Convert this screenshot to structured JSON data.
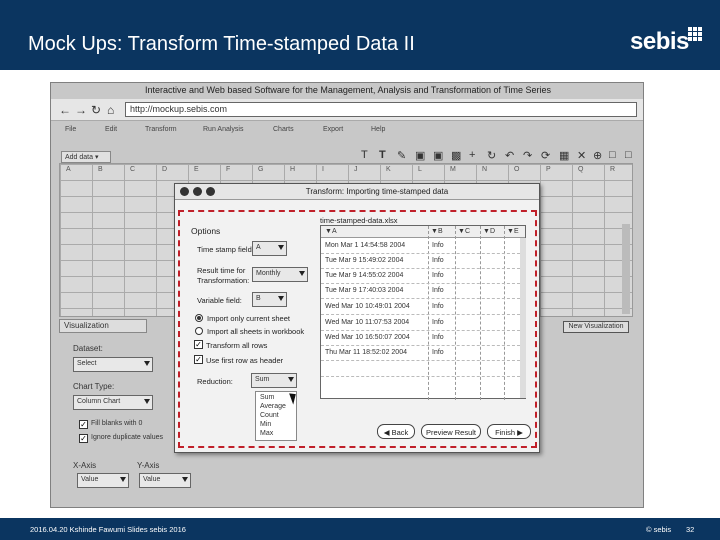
{
  "slide": {
    "title": "Mock Ups: Transform Time-stamped Data II",
    "logo": "sebis",
    "footer_left": "2016.04.20 Kshinde Fawumi Slides sebis 2016",
    "footer_copyright": "© sebis",
    "page_number": "32"
  },
  "app": {
    "title": "Interactive and Web based Software for the Management, Analysis and Transformation of Time Series",
    "url": "http://mockup.sebis.com",
    "menu": [
      "File",
      "Edit",
      "Transform",
      "Run Analysis",
      "Charts",
      "Export",
      "Help"
    ],
    "sheet_tab": "Add data",
    "grid_cols": [
      "A",
      "B",
      "C",
      "D",
      "E",
      "F",
      "G",
      "H",
      "I",
      "J",
      "K",
      "L",
      "M",
      "N",
      "O",
      "P",
      "Q",
      "R"
    ],
    "toolbar_icons": [
      "text-icon",
      "bold-icon",
      "edit-icon",
      "image-icon",
      "image2-icon",
      "save-icon",
      "add-icon",
      "refresh-icon",
      "undo-icon",
      "redo-icon",
      "rotate-icon",
      "trash-icon",
      "close-icon",
      "zoom-in-icon",
      "lock-icon",
      "unlock-icon"
    ]
  },
  "viz": {
    "header": "Visualization",
    "new_button": "New Visualization",
    "dataset_label": "Dataset:",
    "dataset_value": "Select",
    "chart_type_label": "Chart Type:",
    "chart_type_value": "Column Chart",
    "fill_blanks": "Fill blanks with 0",
    "ignore_dupes": "Ignore duplicate values",
    "x_axis_label": "X-Axis",
    "y_axis_label": "Y-Axis",
    "x_axis_value": "Value",
    "y_axis_value": "Value"
  },
  "dialog": {
    "title": "Transform: Importing time-stamped data",
    "options_label": "Options",
    "timestamp_field_label": "Time stamp field:",
    "timestamp_field_value": "A",
    "result_label_1": "Result time for",
    "result_label_2": "Transformation:",
    "result_value": "Monthly",
    "variable_field_label": "Variable field:",
    "variable_field_value": "B",
    "radio_current": "Import only current sheet",
    "radio_all": "Import all sheets in workbook",
    "check_transform_all": "Transform all rows",
    "check_first_row": "Use first row as header",
    "reduction_label": "Reduction:",
    "reduction_value": "Sum",
    "reduction_options": [
      "Sum",
      "Average",
      "Count",
      "Min",
      "Max"
    ],
    "file_name": "time-stamped-data.xlsx",
    "columns": [
      "A",
      "B",
      "C",
      "D",
      "E"
    ],
    "rows": [
      [
        "Mon Mar 1 14:54:58 2004",
        "Info"
      ],
      [
        "Tue Mar 9 15:49:02 2004",
        "Info"
      ],
      [
        "Tue Mar 9 14:55:02 2004",
        "Info"
      ],
      [
        "Tue Mar 9 17:40:03 2004",
        "Info"
      ],
      [
        "Wed Mar 10 10:49:01 2004",
        "Info"
      ],
      [
        "Wed Mar 10 11:07:53 2004",
        "Info"
      ],
      [
        "Wed Mar 10 16:50:07 2004",
        "Info"
      ],
      [
        "Thu Mar 11 18:52:02 2004",
        "Info"
      ]
    ],
    "back_button": "Back",
    "preview_button": "Preview Result",
    "finish_button": "Finish"
  }
}
